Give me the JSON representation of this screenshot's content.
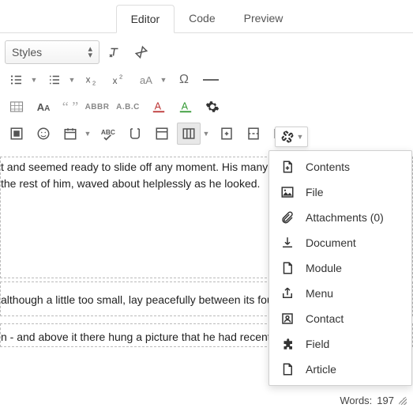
{
  "tabs": {
    "editor": "Editor",
    "code": "Code",
    "preview": "Preview"
  },
  "toolbar": {
    "styles_label": "Styles",
    "abbr": "ABBR",
    "abc": "A.B.C"
  },
  "content": {
    "p1": "t and seemed ready to slide off any moment. His many le",
    "p2": "the rest of him, waved about helplessly as he looked.",
    "p3": "although a little too small, lay peacefully between its four",
    "p4": "n - and above it there hung a picture that he had recentl"
  },
  "status": {
    "words_label": "Words:",
    "words_count": "197"
  },
  "dropdown": {
    "contents": "Contents",
    "file": "File",
    "attachments": "Attachments (0)",
    "document": "Document",
    "module": "Module",
    "menu": "Menu",
    "contact": "Contact",
    "field": "Field",
    "article": "Article"
  }
}
